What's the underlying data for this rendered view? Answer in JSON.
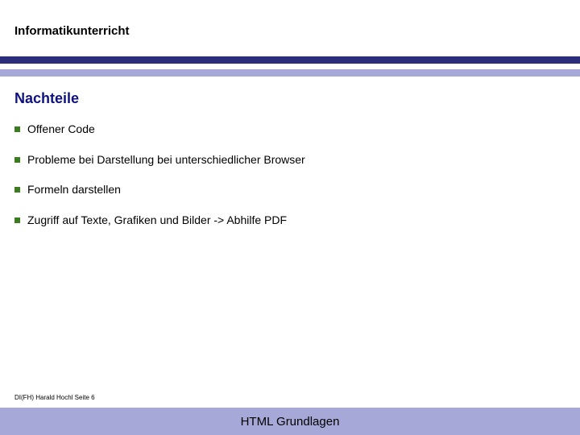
{
  "header": {
    "title": "Informatikunterricht"
  },
  "section": {
    "title": "Nachteile"
  },
  "bullets": [
    {
      "text": "Offener Code"
    },
    {
      "text": "Probleme bei Darstellung bei unterschiedlicher Browser"
    },
    {
      "text": "Formeln darstellen"
    },
    {
      "text": "Zugriff auf Texte, Grafiken und Bilder -> Abhilfe PDF"
    }
  ],
  "footer": {
    "left": "DI(FH) Harald Hochl  Seite 6",
    "bar": "HTML Grundlagen"
  }
}
